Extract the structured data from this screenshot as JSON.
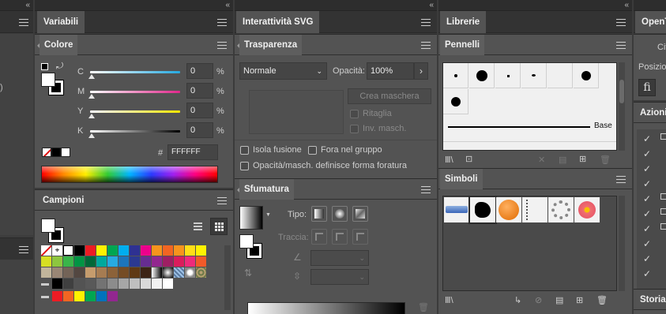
{
  "columns": {
    "c1_chev": "«",
    "c2_chev": "«",
    "c3_chev": "«",
    "c4_chev": "«"
  },
  "variabili": {
    "title": "Variabili"
  },
  "colore": {
    "title": "Colore",
    "channels": [
      {
        "label": "C",
        "value": "0",
        "unit": "%"
      },
      {
        "label": "M",
        "value": "0",
        "unit": "%"
      },
      {
        "label": "Y",
        "value": "0",
        "unit": "%"
      },
      {
        "label": "K",
        "value": "0",
        "unit": "%"
      }
    ],
    "hash": "#",
    "hex": "FFFFFF"
  },
  "campioni": {
    "title": "Campioni"
  },
  "interattivita": {
    "title": "Interattività SVG"
  },
  "trasparenza": {
    "title": "Trasparenza",
    "blend_mode": "Normale",
    "opacity_label": "Opacità:",
    "opacity_value": "100%",
    "make_mask": "Crea maschera",
    "clip": "Ritaglia",
    "invert_mask": "Inv. masch.",
    "isolate": "Isola fusione",
    "knockout": "Fora nel gruppo",
    "opacity_mask": "Opacità/masch. definisce forma foratura"
  },
  "sfumatura": {
    "title": "Sfumatura",
    "type_label": "Tipo:",
    "stroke_label": "Traccia:"
  },
  "librerie": {
    "title": "Librerie"
  },
  "pennelli": {
    "title": "Pennelli",
    "base_label": "Base"
  },
  "simboli": {
    "title": "Simboli"
  },
  "right": {
    "top_tab": "OpenT",
    "ci": "Cit",
    "posizione": "Posizio",
    "fi_glyph": "fi",
    "azioni": "Azioni",
    "storia": "Storia"
  }
}
